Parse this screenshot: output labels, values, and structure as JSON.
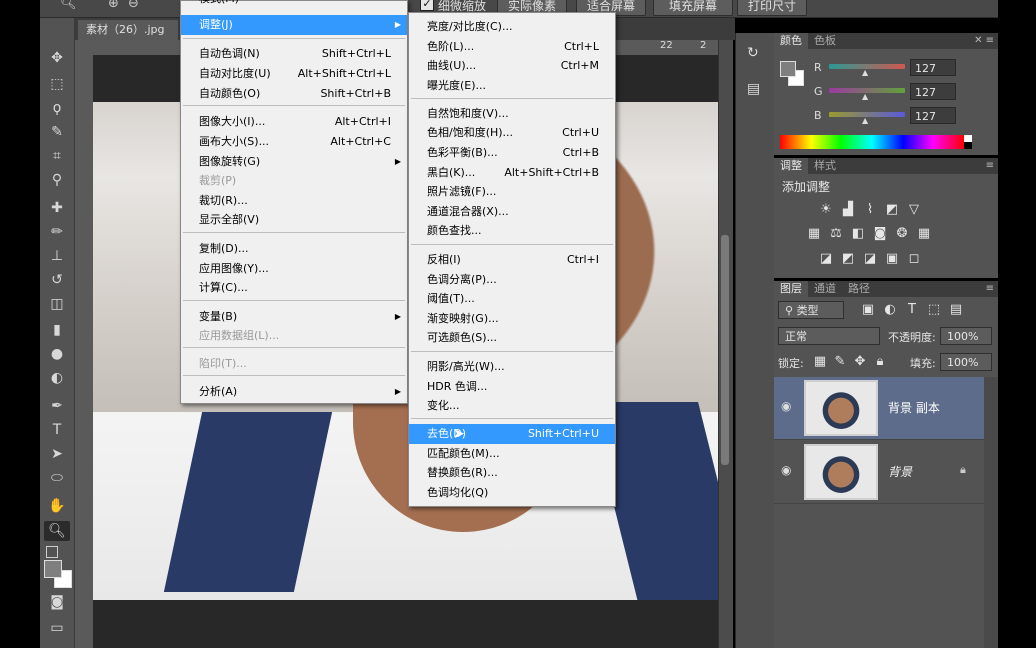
{
  "option_bar": {
    "fine_zoom_label": "细微缩放",
    "buttons": [
      "实际像素",
      "适合屏幕",
      "填充屏幕",
      "打印尺寸"
    ]
  },
  "document": {
    "tab_title": "素材（26）.jpg @",
    "ruler_labels": [
      "22",
      "2"
    ]
  },
  "image_menu": {
    "partial_top": "模式(M)",
    "items": [
      {
        "label": "调整(J)",
        "shortcut": "",
        "submenu": true,
        "highlight": true,
        "disabled": false
      },
      {
        "label": "自动色调(N)",
        "shortcut": "Shift+Ctrl+L"
      },
      {
        "label": "自动对比度(U)",
        "shortcut": "Alt+Shift+Ctrl+L"
      },
      {
        "label": "自动颜色(O)",
        "shortcut": "Shift+Ctrl+B"
      },
      {
        "label": "图像大小(I)...",
        "shortcut": "Alt+Ctrl+I"
      },
      {
        "label": "画布大小(S)...",
        "shortcut": "Alt+Ctrl+C"
      },
      {
        "label": "图像旋转(G)",
        "shortcut": "",
        "submenu": true
      },
      {
        "label": "裁剪(P)",
        "shortcut": "",
        "disabled": true
      },
      {
        "label": "裁切(R)...",
        "shortcut": ""
      },
      {
        "label": "显示全部(V)",
        "shortcut": ""
      },
      {
        "label": "复制(D)...",
        "shortcut": ""
      },
      {
        "label": "应用图像(Y)...",
        "shortcut": ""
      },
      {
        "label": "计算(C)...",
        "shortcut": ""
      },
      {
        "label": "变量(B)",
        "shortcut": "",
        "submenu": true
      },
      {
        "label": "应用数据组(L)...",
        "shortcut": "",
        "disabled": true
      },
      {
        "label": "陷印(T)...",
        "shortcut": "",
        "disabled": true
      },
      {
        "label": "分析(A)",
        "shortcut": "",
        "submenu": true
      }
    ]
  },
  "adjust_submenu": {
    "items": [
      {
        "label": "亮度/对比度(C)...",
        "shortcut": ""
      },
      {
        "label": "色阶(L)...",
        "shortcut": "Ctrl+L"
      },
      {
        "label": "曲线(U)...",
        "shortcut": "Ctrl+M"
      },
      {
        "label": "曝光度(E)...",
        "shortcut": ""
      },
      {
        "label": "自然饱和度(V)...",
        "shortcut": ""
      },
      {
        "label": "色相/饱和度(H)...",
        "shortcut": "Ctrl+U"
      },
      {
        "label": "色彩平衡(B)...",
        "shortcut": "Ctrl+B"
      },
      {
        "label": "黑白(K)...",
        "shortcut": "Alt+Shift+Ctrl+B"
      },
      {
        "label": "照片滤镜(F)...",
        "shortcut": ""
      },
      {
        "label": "通道混合器(X)...",
        "shortcut": ""
      },
      {
        "label": "颜色查找...",
        "shortcut": ""
      },
      {
        "label": "反相(I)",
        "shortcut": "Ctrl+I"
      },
      {
        "label": "色调分离(P)...",
        "shortcut": ""
      },
      {
        "label": "阈值(T)...",
        "shortcut": ""
      },
      {
        "label": "渐变映射(G)...",
        "shortcut": ""
      },
      {
        "label": "可选颜色(S)...",
        "shortcut": ""
      },
      {
        "label": "阴影/高光(W)...",
        "shortcut": ""
      },
      {
        "label": "HDR 色调...",
        "shortcut": ""
      },
      {
        "label": "变化...",
        "shortcut": ""
      },
      {
        "label": "去色(D)",
        "shortcut": "Shift+Ctrl+U",
        "highlight": true
      },
      {
        "label": "匹配颜色(M)...",
        "shortcut": ""
      },
      {
        "label": "替换颜色(R)...",
        "shortcut": ""
      },
      {
        "label": "色调均化(Q)",
        "shortcut": ""
      }
    ]
  },
  "color_panel": {
    "tabs": [
      "颜色",
      "色板"
    ],
    "channels": [
      {
        "label": "R",
        "value": "127",
        "gradient": [
          "#2b9a94",
          "#d0584f"
        ]
      },
      {
        "label": "G",
        "value": "127",
        "gradient": [
          "#9a3aa0",
          "#62a23a"
        ]
      },
      {
        "label": "B",
        "value": "127",
        "gradient": [
          "#9a9a2e",
          "#5a5ad8"
        ]
      }
    ]
  },
  "adjustments_panel": {
    "tabs": [
      "调整",
      "样式"
    ],
    "title": "添加调整",
    "icon_rows": [
      [
        "brightness-icon",
        "levels-icon",
        "curves-icon",
        "exposure-icon",
        "vibrance-icon"
      ],
      [
        "hue-saturation-icon",
        "color-balance-icon",
        "black-white-icon",
        "photo-filter-icon",
        "channel-mixer-icon",
        "color-lookup-icon"
      ],
      [
        "invert-icon",
        "posterize-icon",
        "threshold-icon",
        "gradient-map-icon",
        "selective-color-icon"
      ]
    ]
  },
  "layers_panel": {
    "tabs": [
      "图层",
      "通道",
      "路径"
    ],
    "filter_kind": "类型",
    "blend_mode": "正常",
    "opacity_label": "不透明度:",
    "opacity_value": "100%",
    "lock_label": "锁定:",
    "fill_label": "填充:",
    "fill_value": "100%",
    "layers": [
      {
        "name": "背景 副本",
        "selected": true,
        "locked": false
      },
      {
        "name": "背景",
        "selected": false,
        "locked": true
      }
    ]
  }
}
